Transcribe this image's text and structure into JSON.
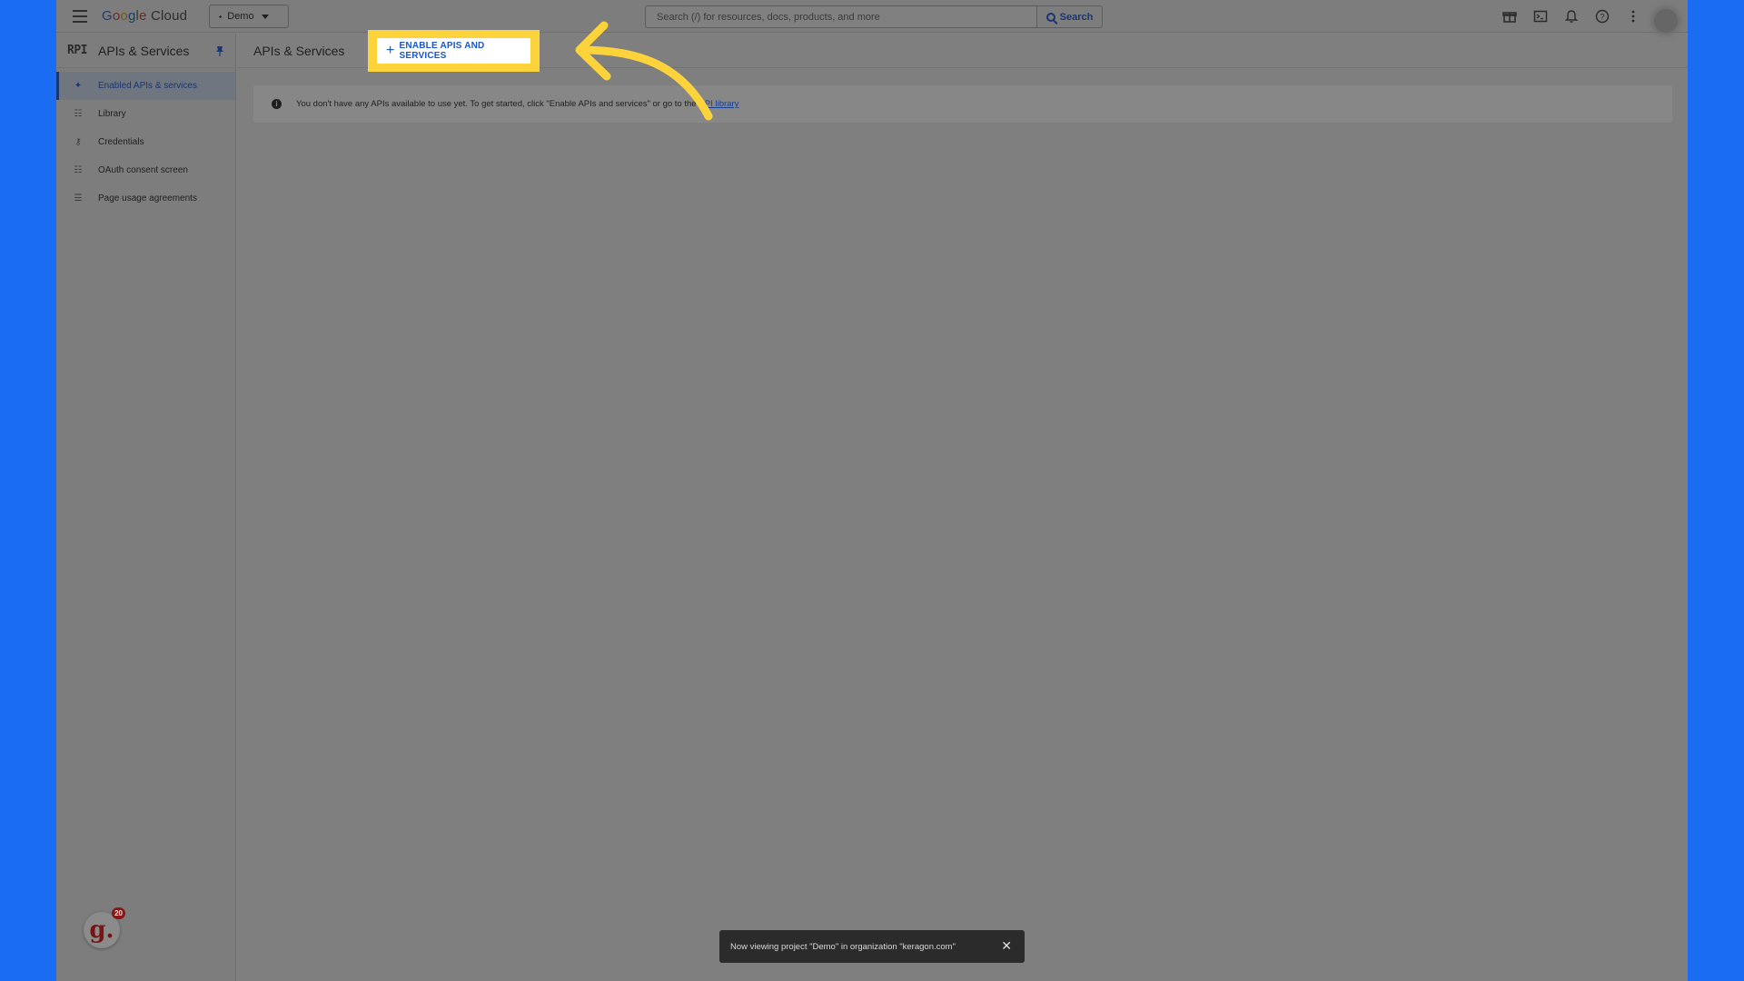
{
  "topbar": {
    "logo_text": "Google Cloud",
    "project_label": "Demo",
    "search_placeholder": "Search (/) for resources, docs, products, and more",
    "search_button": "Search",
    "icons": [
      "gift-icon",
      "terminal-icon",
      "bell-icon",
      "help-icon",
      "more-vert-icon"
    ]
  },
  "sidebar": {
    "badge": "RPI",
    "title": "APIs & Services",
    "items": [
      {
        "label": "Enabled APIs & services",
        "icon": "diamond-dots-icon",
        "active": true
      },
      {
        "label": "Library",
        "icon": "grid-icon",
        "active": false
      },
      {
        "label": "Credentials",
        "icon": "key-icon",
        "active": false
      },
      {
        "label": "OAuth consent screen",
        "icon": "consent-icon",
        "active": false
      },
      {
        "label": "Page usage agreements",
        "icon": "settings-list-icon",
        "active": false
      }
    ],
    "app_badge_letter": "g.",
    "app_badge_count": "20"
  },
  "content": {
    "title": "APIs & Services",
    "enable_button": "ENABLE APIS AND SERVICES",
    "info_text": "You don't have any APIs available to use yet. To get started, click \"Enable APIs and services\" or go to the",
    "info_link": "API library"
  },
  "snackbar": {
    "message": "Now viewing project \"Demo\" in organization \"keragon.com\""
  },
  "colors": {
    "page_bg": "#1a6df2",
    "highlight": "#fcd33b",
    "accent": "#1a55c9"
  }
}
